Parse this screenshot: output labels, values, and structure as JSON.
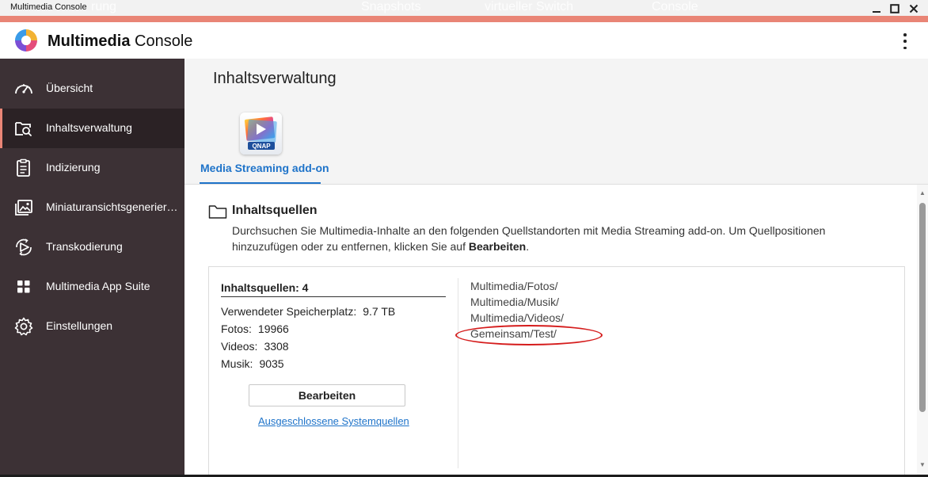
{
  "window": {
    "title": "Multimedia Console",
    "ghost_tabs": [
      "rung",
      "Snapshots",
      "virtueller Switch",
      "Console"
    ]
  },
  "app": {
    "name_bold": "Multimedia",
    "name_rest": " Console"
  },
  "sidebar": {
    "items": [
      {
        "label": "Übersicht",
        "icon": "speedometer-icon",
        "active": false
      },
      {
        "label": "Inhaltsverwaltung",
        "icon": "content-search-icon",
        "active": true
      },
      {
        "label": "Indizierung",
        "icon": "clipboard-icon",
        "active": false
      },
      {
        "label": "Miniaturansichtsgenerierung",
        "icon": "image-gallery-icon",
        "active": false
      },
      {
        "label": "Transkodierung",
        "icon": "transcode-icon",
        "active": false
      },
      {
        "label": "Multimedia App Suite",
        "icon": "app-grid-icon",
        "active": false
      },
      {
        "label": "Einstellungen",
        "icon": "gear-icon",
        "active": false
      }
    ]
  },
  "main": {
    "title": "Inhaltsverwaltung",
    "tab": {
      "label": "Media Streaming add-on",
      "icon": "qnap-media-streaming-icon",
      "icon_text": "QNAP"
    },
    "section": {
      "title": "Inhaltsquellen",
      "description_pre": "Durchsuchen Sie Multimedia-Inhalte an den folgenden Quellstandorten mit Media Streaming add-on. Um Quellpositionen hinzuzufügen oder zu entfernen, klicken Sie auf ",
      "description_bold": "Bearbeiten",
      "description_post": "."
    },
    "stats": {
      "title": "Inhaltsquellen: 4",
      "storage_label": "Verwendeter Speicherplatz:",
      "storage_value": "9.7 TB",
      "photos_label": "Fotos:",
      "photos_value": "19966",
      "videos_label": "Videos:",
      "videos_value": "3308",
      "music_label": "Musik:",
      "music_value": "9035"
    },
    "edit_button": "Bearbeiten",
    "excluded_link": "Ausgeschlossene Systemquellen",
    "paths": [
      "Multimedia/Fotos/",
      "Multimedia/Musik/",
      "Multimedia/Videos/",
      "Gemeinsam/Test/"
    ]
  },
  "colors": {
    "accent": "#e98576",
    "sidebar_bg": "#3c3135",
    "link_blue": "#1e73c9",
    "annotation_red": "#d51c1c"
  }
}
